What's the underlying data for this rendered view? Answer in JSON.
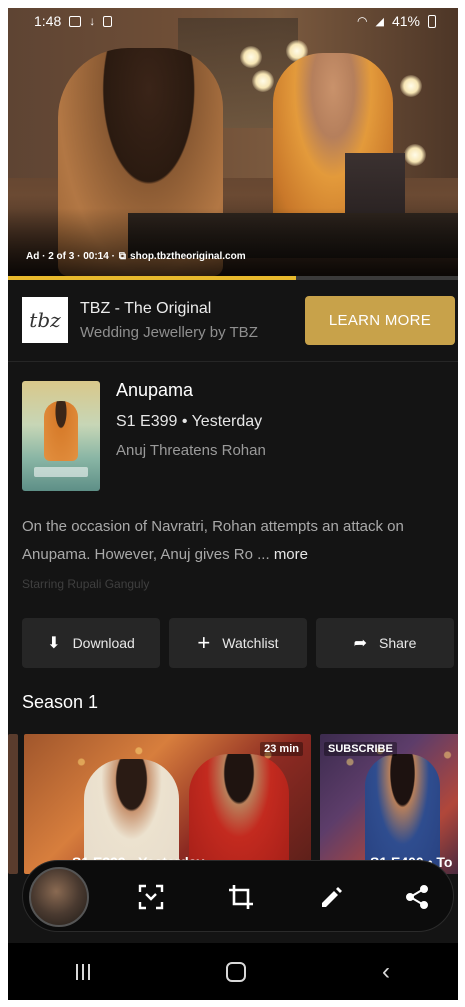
{
  "status_bar": {
    "time": "1:48",
    "battery": "41%"
  },
  "player": {
    "ad_label": "Ad · 2 of 3 · 00:14 · ",
    "ad_link_icon": "external-link-icon",
    "ad_url": "shop.tbztheoriginal.com",
    "progress_fraction": 0.64,
    "progress_color": "#e7b92d"
  },
  "ad_banner": {
    "logo_text": "tbz",
    "title": "TBZ - The Original",
    "subtitle": "Wedding Jewellery by TBZ",
    "cta_label": "LEARN MORE",
    "cta_color": "#c8a24a"
  },
  "show": {
    "title": "Anupama",
    "episode_line": "S1 E399 • Yesterday",
    "episode_title": "Anuj Threatens Rohan",
    "description": "On the occasion of Navratri, Rohan attempts an attack on Anupama. However, Anuj gives Ro ... ",
    "more_label": "more",
    "starring": "Starring Rupali Ganguly"
  },
  "actions": [
    {
      "label": "Download",
      "icon": "download-icon"
    },
    {
      "label": "Watchlist",
      "icon": "plus-icon"
    },
    {
      "label": "Share",
      "icon": "share-arrow-icon"
    }
  ],
  "season": {
    "title": "Season 1",
    "episodes": [
      {
        "badge": "23 min",
        "label": "S1 E399 • Yesterday"
      },
      {
        "badge": "SUBSCRIBE",
        "label": "S1 E400 • To"
      }
    ]
  },
  "screenshot_toolbar": {
    "buttons": [
      "scroll-capture-icon",
      "crop-icon",
      "pencil-icon",
      "share-icon"
    ]
  }
}
